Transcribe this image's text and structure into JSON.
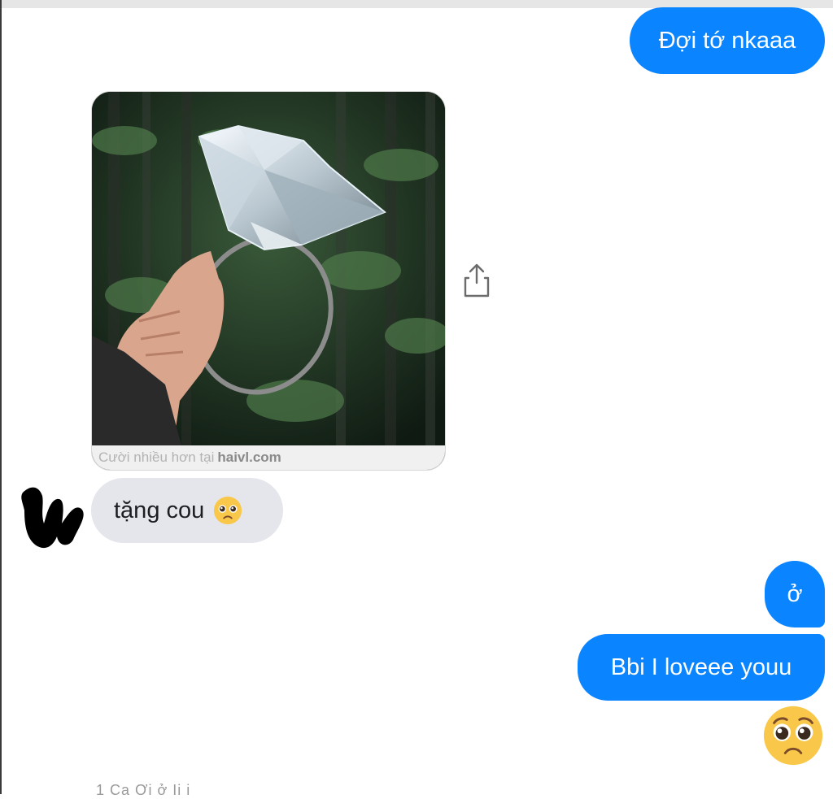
{
  "messages": {
    "sent_1": "Đợi tớ nkaaa",
    "photo_caption_prefix": "Cười nhiều hơn tại",
    "photo_caption_site": "haivl.com",
    "received_1": "tặng cou",
    "received_1_emoji": "pleading-face",
    "sent_2": "ở",
    "sent_3": "Bbi I loveee youu",
    "sent_4_emoji": "pleading-face",
    "cut_off_text": "1 Ca Ơi ở Ii i"
  },
  "colors": {
    "sent_bubble": "#0a84ff",
    "received_bubble": "#e4e6eb",
    "background": "#ffffff"
  },
  "icons": {
    "share": "share-icon",
    "avatar": "avatar-redacted"
  }
}
